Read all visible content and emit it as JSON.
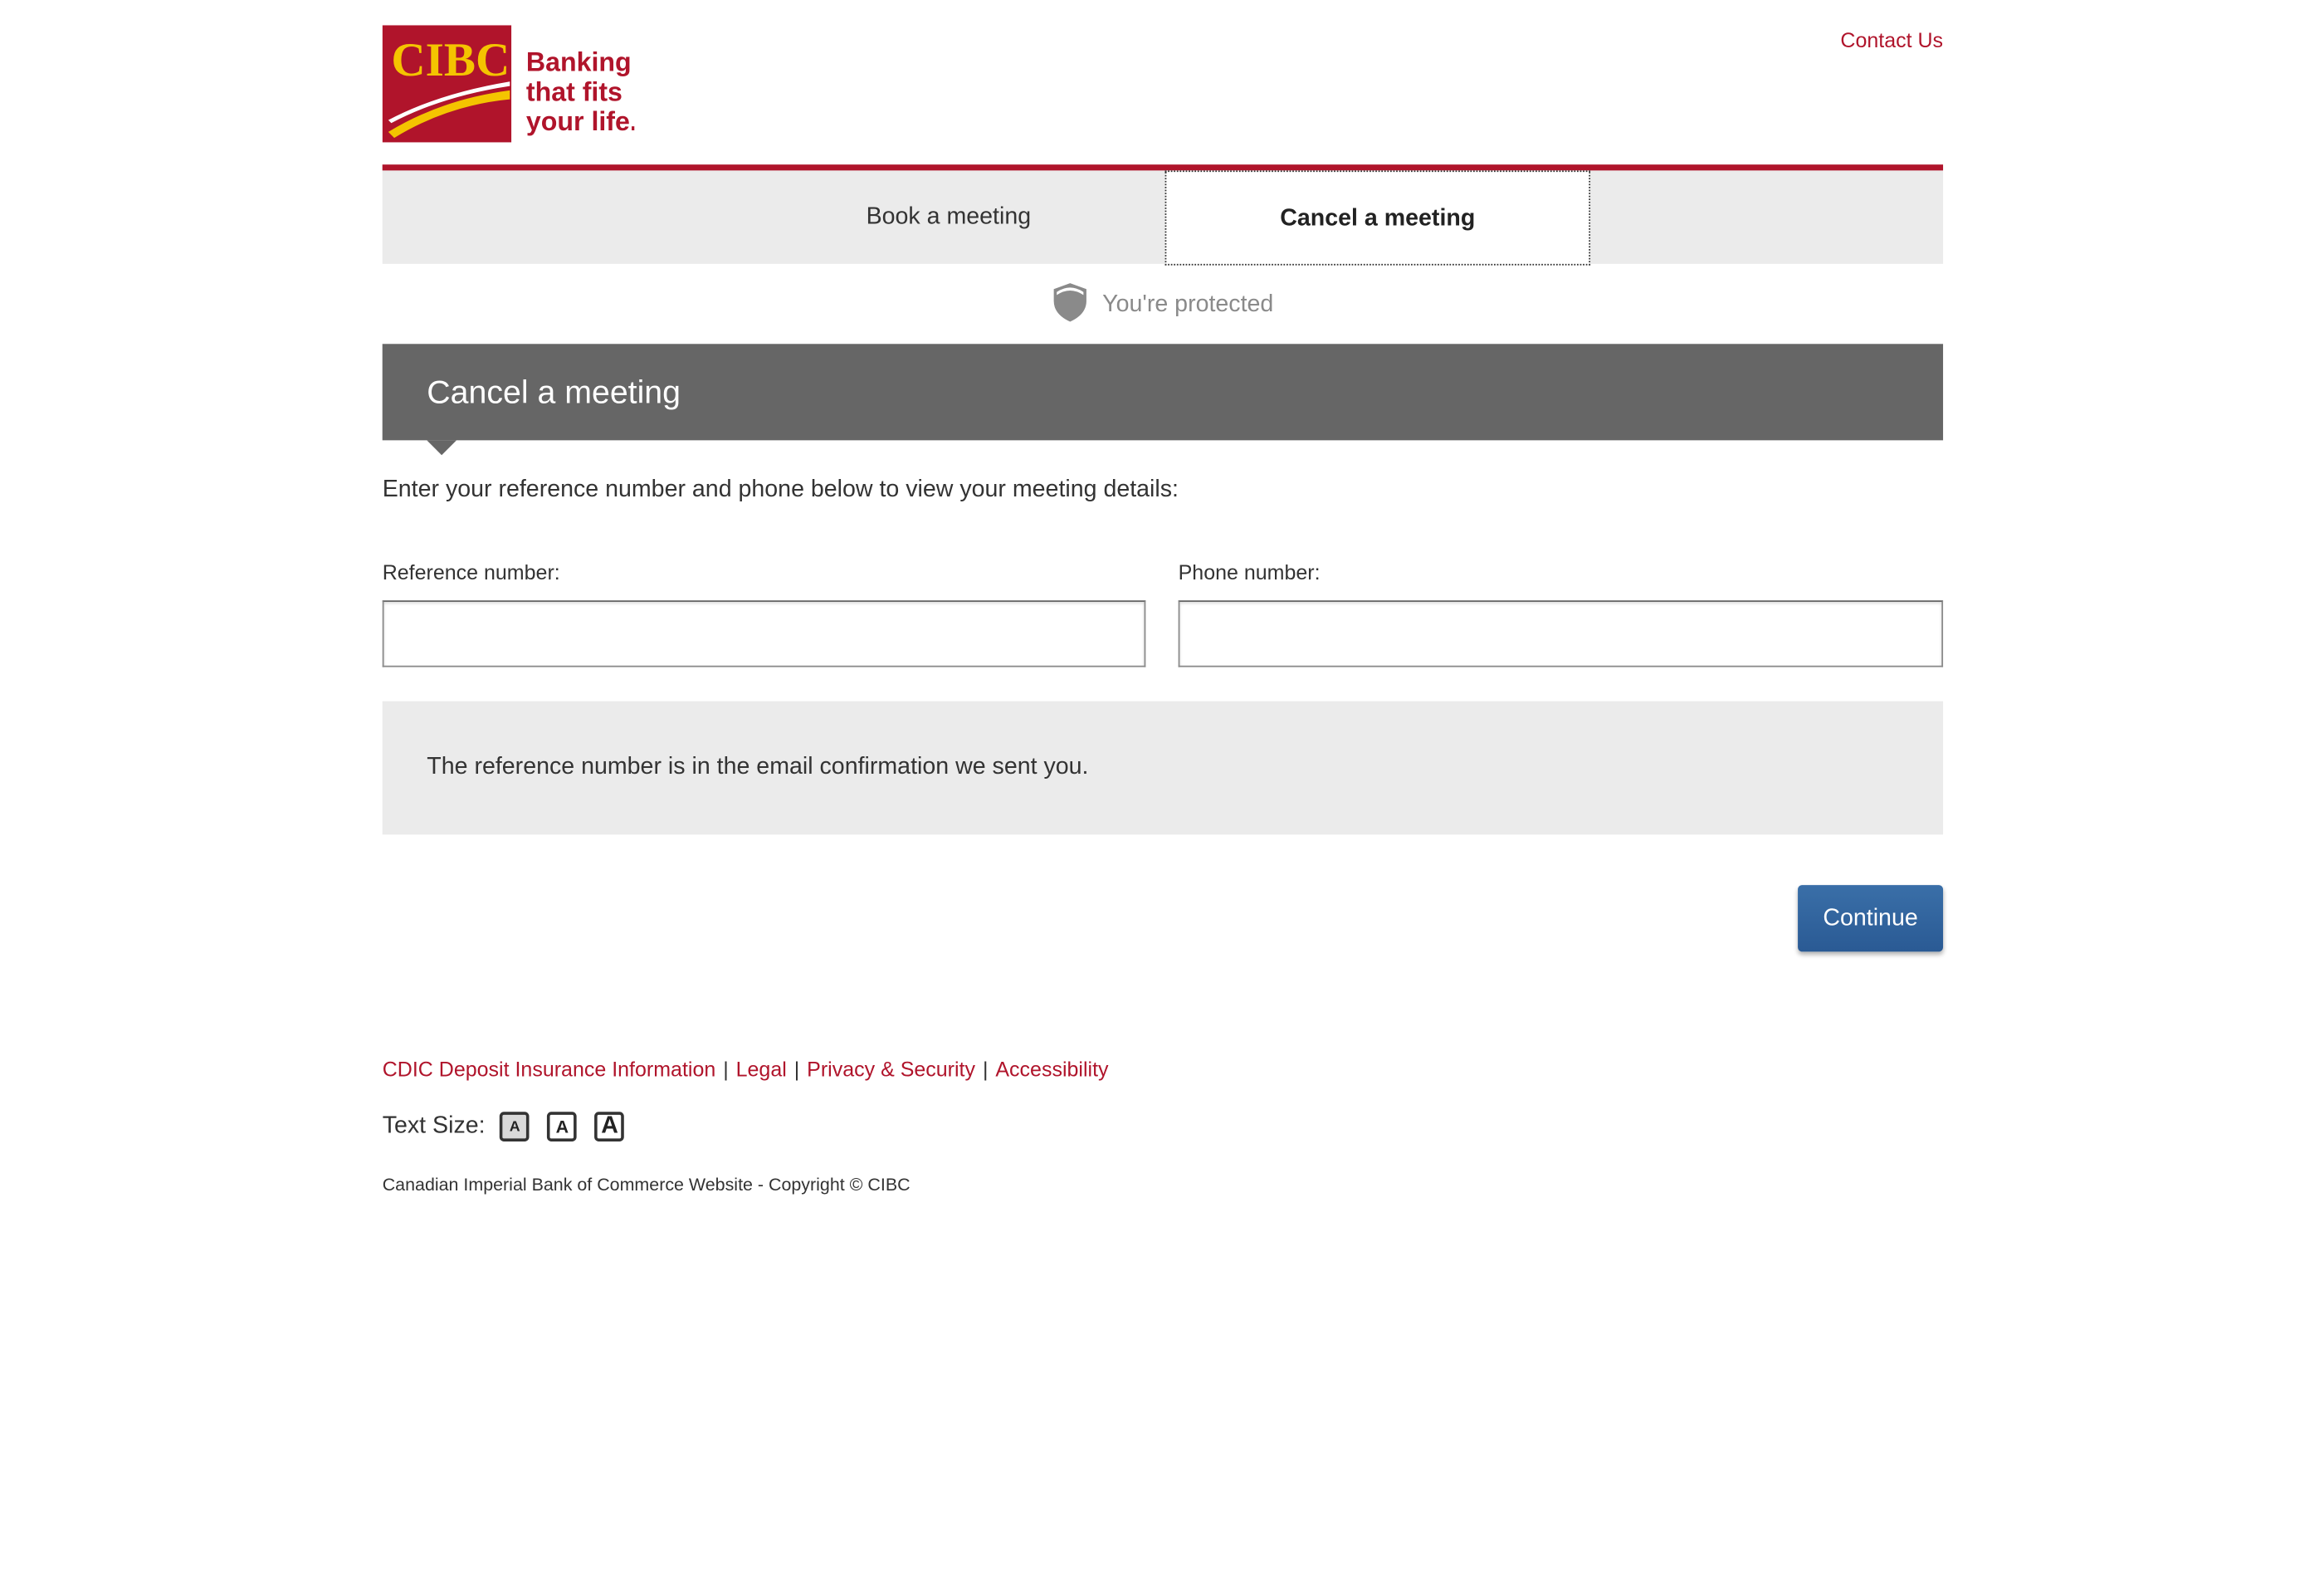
{
  "header": {
    "logo_wordmark": "CIBC",
    "logo_tagline": [
      "Banking",
      "that fits",
      "your life."
    ],
    "contact_label": "Contact Us"
  },
  "tabs": [
    {
      "label": "Book a meeting",
      "active": false
    },
    {
      "label": "Cancel a meeting",
      "active": true
    }
  ],
  "security": {
    "text": "You're protected",
    "icon": "shield-icon"
  },
  "main": {
    "title": "Cancel a meeting",
    "intro": "Enter your reference number and phone below to view your meeting details:",
    "reference_label": "Reference number:",
    "reference_value": "",
    "phone_label": "Phone number:",
    "phone_value": "",
    "info": "The reference number is in the email confirmation we sent you.",
    "continue_label": "Continue"
  },
  "footer": {
    "links": [
      "CDIC Deposit Insurance Information",
      "Legal",
      "Privacy & Security",
      "Accessibility"
    ],
    "text_size_label": "Text Size:",
    "text_size_buttons": [
      "A",
      "A",
      "A"
    ],
    "copyright": "Canadian Imperial Bank of Commerce Website - Copyright © CIBC"
  },
  "colors": {
    "brand_red": "#b0142b",
    "brand_yellow": "#f4c400",
    "banner_gray": "#666666",
    "button_blue": "#2a5a94"
  }
}
